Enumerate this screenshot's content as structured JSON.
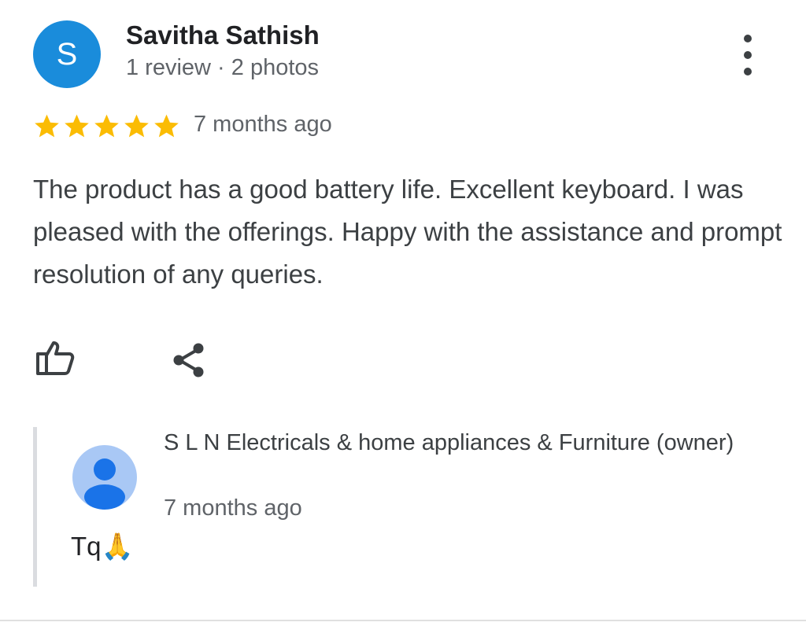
{
  "review": {
    "reviewer_initial": "S",
    "reviewer_name": "Savitha Sathish",
    "reviewer_meta": "1 review · 2 photos",
    "rating": 5,
    "rating_max": 5,
    "time": "7 months ago",
    "text": "The product has a good battery life. Excellent keyboard. I was pleased with the offerings. Happy with the assistance and prompt resolution of any queries.",
    "avatar_color": "#1a8cdb",
    "star_color": "#fbbc04"
  },
  "actions": {
    "like_icon": "thumbs-up-icon",
    "share_icon": "share-icon",
    "more_icon": "more-vert-icon"
  },
  "owner_reply": {
    "name": "S L N Electricals & home appliances & Furniture (owner)",
    "time": "7 months ago",
    "text": "Tq🙏"
  }
}
